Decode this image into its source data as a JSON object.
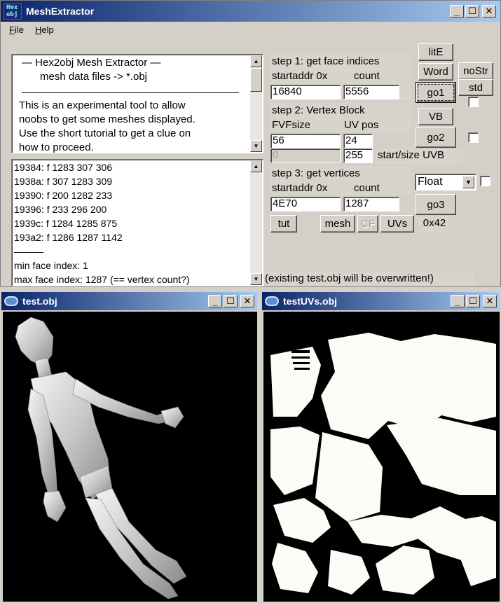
{
  "main_window": {
    "title": "MeshExtractor",
    "icon_text": "H⊕x\nobj",
    "controls": {
      "minimize": "_",
      "maximize": "☐",
      "close": "✕"
    }
  },
  "menu": {
    "file": "File",
    "help": "Help"
  },
  "description": {
    "heading1": "—   Hex2obj Mesh Extractor   —",
    "heading2": "mesh data files -> *.obj",
    "body1": "This is an experimental tool to allow",
    "body2": "noobs to get some meshes displayed.",
    "body3": "Use the short tutorial to get a clue on",
    "body4": "how to proceed."
  },
  "face_log": {
    "lines": [
      "19384: f  1283 307 306",
      "1938a: f  307 1283 309",
      "19390: f  200 1282 233",
      "19396: f  233 296 200",
      "1939c: f  1284 1285 875",
      "193a2: f  1286 1287 1142"
    ],
    "separator": "———",
    "min_face": "min face index: 1",
    "max_face": "max face index: 1287 (== vertex count?)"
  },
  "step1": {
    "title": "step 1: get face indices",
    "startaddr_label": "startaddr 0x",
    "count_label": "count",
    "startaddr": "16840",
    "count": "5556"
  },
  "step2": {
    "title": "step 2: Vertex Block",
    "fvf_label": "FVFsize",
    "uv_label": "UV pos",
    "fvfsize": "56",
    "uvpos": "24",
    "uvb_start": "0",
    "uvb_size": "255",
    "uvb_label": "start/size UVB"
  },
  "step3": {
    "title": "step 3: get vertices",
    "startaddr_label": "startaddr 0x",
    "count_label": "count",
    "startaddr": "4E70",
    "count": "1287",
    "format": "Float"
  },
  "buttons": {
    "litE": "litE",
    "word": "Word",
    "nostr": "noStr",
    "std": "std",
    "go1": "go1",
    "vb": "VB",
    "go2": "go2",
    "go3": "go3",
    "tut": "tut",
    "mesh": "mesh",
    "cf": "CF",
    "uvs": "UVs",
    "hex": "0x42"
  },
  "status": "(existing test.obj will be overwritten!)",
  "mesh_window": {
    "title": "test.obj"
  },
  "uv_window": {
    "title": "testUVs.obj"
  },
  "colors": {
    "title_dark": "#0a246a",
    "title_light": "#a6caf0",
    "face": "#d4d0c8",
    "viewport_bg": "#000000",
    "uv_fill": "#fcfcf6"
  }
}
